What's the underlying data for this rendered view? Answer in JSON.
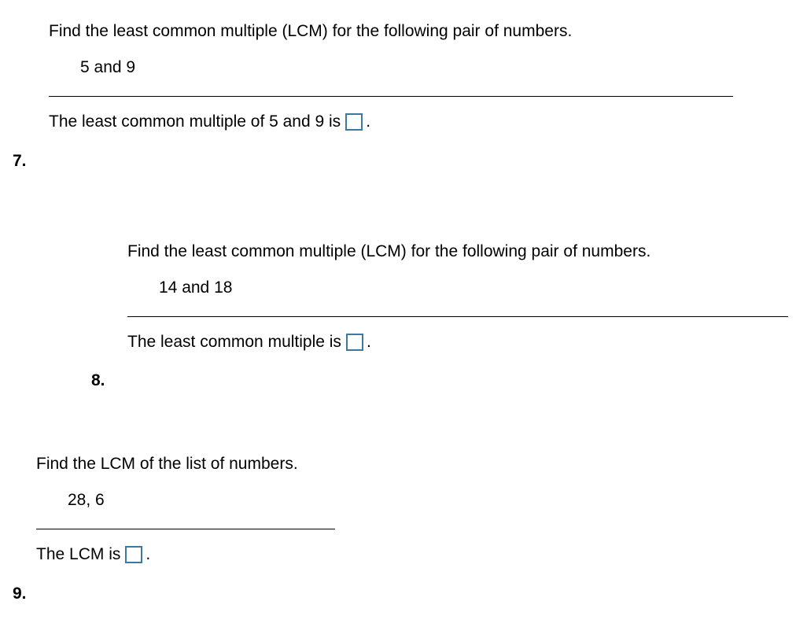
{
  "problems": [
    {
      "number": "7.",
      "instruction": "Find the least common multiple (LCM) for the following pair of numbers.",
      "numbers": "5 and 9",
      "answer_prefix": "The least common multiple of 5 and 9 is",
      "answer_suffix": "."
    },
    {
      "number": "8.",
      "instruction": "Find the least common multiple (LCM) for the following pair of numbers.",
      "numbers": "14 and 18",
      "answer_prefix": "The least common multiple is",
      "answer_suffix": "."
    },
    {
      "number": "9.",
      "instruction": "Find the LCM of the list of numbers.",
      "numbers": "28, 6",
      "answer_prefix": "The LCM is",
      "answer_suffix": "."
    }
  ]
}
